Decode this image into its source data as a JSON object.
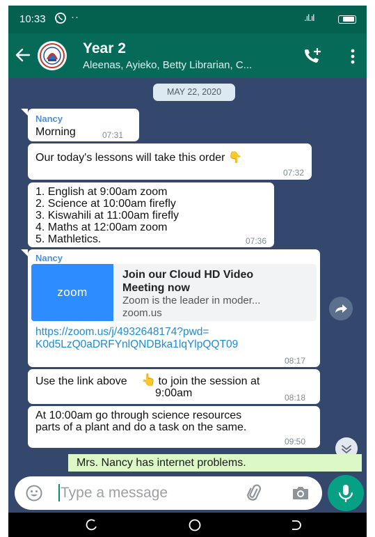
{
  "status_bar": {
    "time": "10:33",
    "dots": "··",
    "signal": ".ıl.ıl"
  },
  "header": {
    "title": "Year 2",
    "subtitle": "Aleenas, Ayieko, Betty Librarian, C..."
  },
  "date_divider": "MAY 22, 2020",
  "messages": [
    {
      "sender": "Nancy",
      "text": "Morning",
      "time": "07:31"
    },
    {
      "text": "Our today's lessons will take this order 👇",
      "time": "07:32"
    },
    {
      "text": "1. English at 9:00am zoom\n2. Science at 10:00am firefly\n3. Kiswahili at 11:00am firefly\n4. Maths at 12:00am zoom\n5. Mathletics.",
      "time": "07:36"
    },
    {
      "sender": "Nancy",
      "preview": {
        "thumb_label": "zoom",
        "title": "Join our Cloud HD Video\nMeeting now",
        "description": "Zoom is the leader in moder...",
        "domain": "zoom.us"
      },
      "link": "https://zoom.us/j/4932648174?pwd=\nK0d5LzQ0aDRFYnlQNDBka1lqYlpQQT09",
      "time": "08:17"
    },
    {
      "text_before": "Use the link above",
      "emoji": "👆",
      "text_after": " to join the session at\n9:00am",
      "time": "08:18"
    },
    {
      "text": "At 10:00am go through science resources\nparts of a plant and do a task on the same.",
      "time": "09:50"
    }
  ],
  "notice": "Mrs. Nancy has internet problems.",
  "input": {
    "placeholder": "Type a message"
  },
  "colors": {
    "header": "#056b58",
    "chat_background": "#34476d",
    "bubble": "#ffffff",
    "link": "#1e8bd5",
    "mic": "#06a084",
    "notice": "#dcf8c6"
  },
  "icons": [
    "whatsapp-icon",
    "back-arrow-icon",
    "group-avatar",
    "add-call-icon",
    "more-options-icon",
    "forward-icon",
    "scroll-down-icon",
    "emoji-icon",
    "attach-icon",
    "camera-icon",
    "mic-icon",
    "back-nav-icon",
    "home-nav-icon",
    "recents-nav-icon"
  ]
}
